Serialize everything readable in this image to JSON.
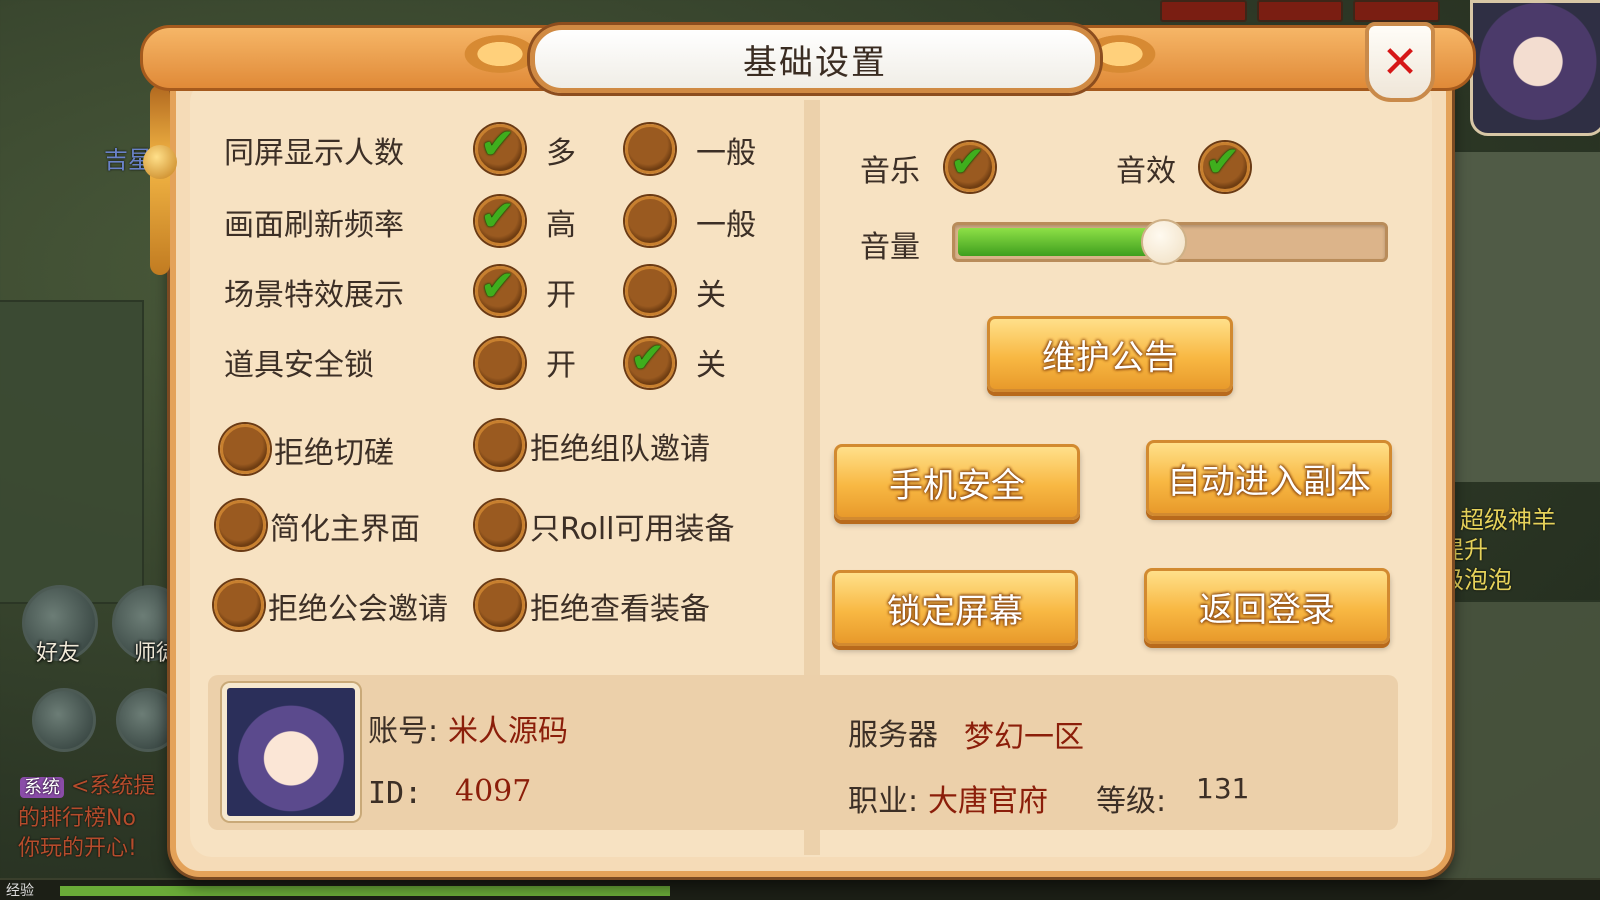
{
  "dialog": {
    "title": "基础设置",
    "close_icon": "close-icon"
  },
  "display_options": [
    {
      "label": "同屏显示人数",
      "opt_a": "多",
      "opt_b": "一般",
      "selected": "a"
    },
    {
      "label": "画面刷新频率",
      "opt_a": "高",
      "opt_b": "一般",
      "selected": "a"
    },
    {
      "label": "场景特效展示",
      "opt_a": "开",
      "opt_b": "关",
      "selected": "a"
    },
    {
      "label": "道具安全锁",
      "opt_a": "开",
      "opt_b": "关",
      "selected": "b"
    }
  ],
  "toggles": [
    {
      "label": "拒绝切磋",
      "checked": false
    },
    {
      "label": "拒绝组队邀请",
      "checked": false
    },
    {
      "label": "简化主界面",
      "checked": false
    },
    {
      "label": "只Roll可用装备",
      "checked": false
    },
    {
      "label": "拒绝公会邀请",
      "checked": false
    },
    {
      "label": "拒绝查看装备",
      "checked": false
    }
  ],
  "audio": {
    "music_label": "音乐",
    "music_on": true,
    "sfx_label": "音效",
    "sfx_on": true,
    "volume_label": "音量",
    "volume_fraction": 0.48
  },
  "buttons": {
    "notice": "维护公告",
    "phone_security": "手机安全",
    "auto_dungeon": "自动进入副本",
    "lock_screen": "锁定屏幕",
    "return_login": "返回登录"
  },
  "account": {
    "account_label": "账号:",
    "account_value": "米人源码",
    "id_label": "ID:",
    "id_value": "4097",
    "server_label": "服务器",
    "server_value": "梦幻一区",
    "job_label": "职业:",
    "job_value": "大唐官府",
    "level_label": "等级:",
    "level_value": "131"
  },
  "background": {
    "friend_label": "好友",
    "master_label": "师徒",
    "system_tag": "系统",
    "chat_1": "<系统提",
    "chat_2": "的排行榜No",
    "chat_3": "你玩的开心!",
    "right_text_1": "超级神羊",
    "right_text_2": "提升",
    "right_text_3": "级泡泡",
    "left_text_1": "吉星",
    "exp_label": "经验",
    "colors": {
      "accent": "#e4a259",
      "check": "#3fae1d",
      "value_red": "#8b1e0a"
    }
  }
}
